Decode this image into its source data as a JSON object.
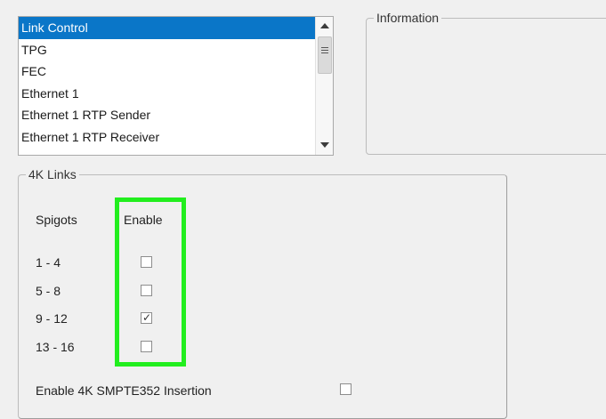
{
  "list": {
    "items": [
      {
        "label": "Link Control",
        "selected": true
      },
      {
        "label": "TPG"
      },
      {
        "label": "FEC"
      },
      {
        "label": "Ethernet 1"
      },
      {
        "label": "Ethernet 1 RTP Sender"
      },
      {
        "label": "Ethernet 1 RTP Receiver"
      }
    ],
    "scroll_up_icon": "chevron-up-icon",
    "scroll_down_icon": "chevron-down-icon"
  },
  "information": {
    "title": "Information"
  },
  "links": {
    "title": "4K Links",
    "spigots_header": "Spigots",
    "enable_header": "Enable",
    "rows": [
      {
        "spigots": "1 - 4",
        "enabled": false
      },
      {
        "spigots": "5 - 8",
        "enabled": false
      },
      {
        "spigots": "9 - 12",
        "enabled": true
      },
      {
        "spigots": "13 - 16",
        "enabled": false
      }
    ],
    "smpte_label": "Enable 4K SMPTE352 Insertion",
    "smpte_enabled": false
  },
  "colors": {
    "selection": "#0a76c8",
    "highlight": "#22ee1e"
  }
}
